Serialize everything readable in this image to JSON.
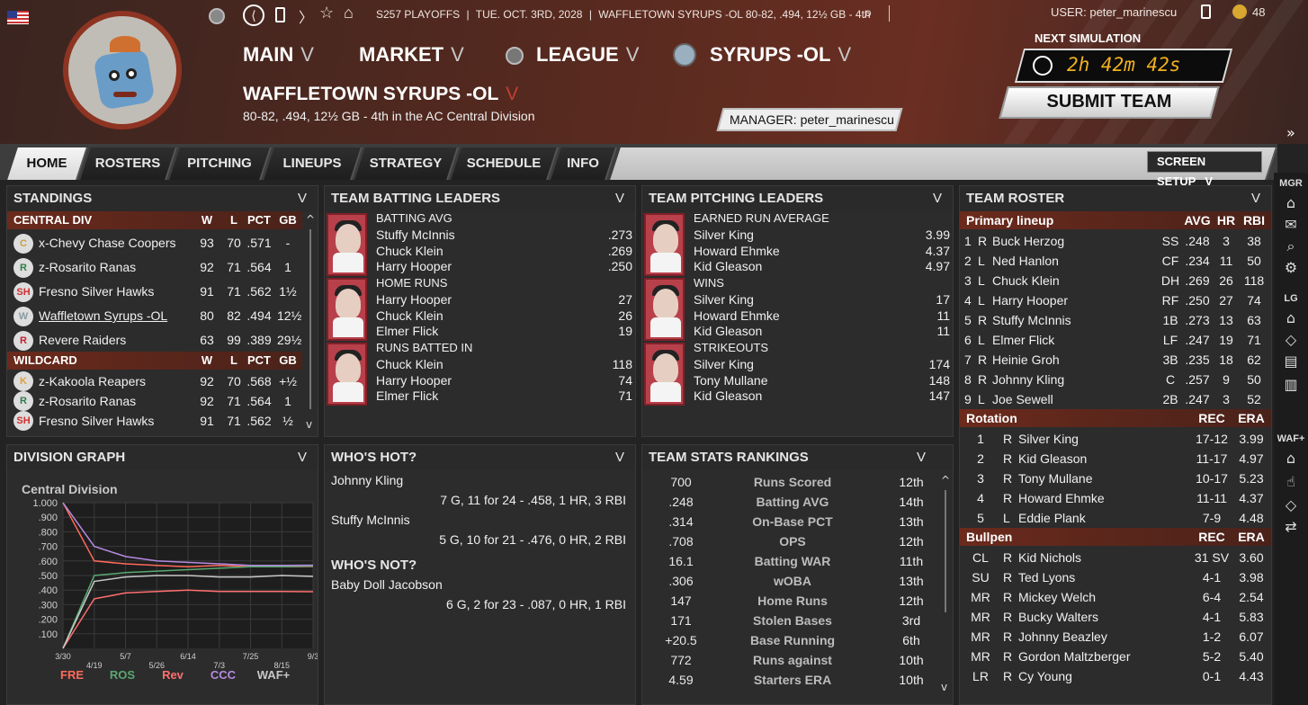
{
  "header": {
    "season_status": "S257 PLAYOFFS",
    "date": "TUE. OCT. 3RD, 2028",
    "team_summary": "WAFFLETOWN SYRUPS -OL  80-82, .494, 12½ GB - 4th",
    "user_label": "USER: peter_marinescu",
    "coins": "48",
    "nav_main": "MAIN",
    "nav_market": "MARKET",
    "nav_league": "LEAGUE",
    "nav_team": "SYRUPS -OL",
    "team_name": "WAFFLETOWN SYRUPS -OL",
    "team_record": "80-82, .494, 12½ GB - 4th in the AC Central Division",
    "manager_label": "MANAGER:",
    "manager_name": "peter_marinescu",
    "next_sim_label": "NEXT SIMULATION",
    "next_sim_time": "2h 42m 42s",
    "submit_label": "SUBMIT TEAM",
    "chev": "V"
  },
  "tabs": [
    "HOME",
    "ROSTERS",
    "PITCHING",
    "LINEUPS",
    "STRATEGY",
    "SCHEDULE",
    "INFO"
  ],
  "screen_setup": "SCREEN SETUP",
  "standings": {
    "title": "STANDINGS",
    "div_header": [
      "CENTRAL DIV",
      "W",
      "L",
      "PCT",
      "GB"
    ],
    "div_rows": [
      {
        "team": "x-Chevy Chase Coopers",
        "w": "93",
        "l": "70",
        "pct": ".571",
        "gb": "-",
        "logo": "C",
        "color": "#c8a040"
      },
      {
        "team": "z-Rosarito Ranas",
        "w": "92",
        "l": "71",
        "pct": ".564",
        "gb": "1",
        "logo": "R",
        "color": "#2e7d4a"
      },
      {
        "team": "Fresno Silver Hawks",
        "w": "91",
        "l": "71",
        "pct": ".562",
        "gb": "1½",
        "logo": "SH",
        "color": "#d03030"
      },
      {
        "team": "Waffletown Syrups -OL",
        "w": "80",
        "l": "82",
        "pct": ".494",
        "gb": "12½",
        "logo": "W",
        "color": "#8a9aa0"
      },
      {
        "team": "Revere Raiders",
        "w": "63",
        "l": "99",
        "pct": ".389",
        "gb": "29½",
        "logo": "R",
        "color": "#c02030"
      }
    ],
    "wc_header": [
      "WILDCARD",
      "W",
      "L",
      "PCT",
      "GB"
    ],
    "wc_rows": [
      {
        "team": "z-Kakoola Reapers",
        "w": "92",
        "l": "70",
        "pct": ".568",
        "gb": "+½",
        "logo": "K",
        "color": "#e0a030"
      },
      {
        "team": "z-Rosarito Ranas",
        "w": "92",
        "l": "71",
        "pct": ".564",
        "gb": "1",
        "logo": "R",
        "color": "#2e7d4a"
      },
      {
        "team": "Fresno Silver Hawks",
        "w": "91",
        "l": "71",
        "pct": ".562",
        "gb": "½",
        "logo": "SH",
        "color": "#d03030"
      }
    ]
  },
  "batting_leaders": {
    "title": "TEAM BATTING LEADERS",
    "groups": [
      {
        "stat": "BATTING AVG",
        "players": [
          [
            "Stuffy McInnis",
            ".273"
          ],
          [
            "Chuck Klein",
            ".269"
          ],
          [
            "Harry Hooper",
            ".250"
          ]
        ]
      },
      {
        "stat": "HOME RUNS",
        "players": [
          [
            "Harry Hooper",
            "27"
          ],
          [
            "Chuck Klein",
            "26"
          ],
          [
            "Elmer Flick",
            "19"
          ]
        ]
      },
      {
        "stat": "RUNS BATTED IN",
        "players": [
          [
            "Chuck Klein",
            "118"
          ],
          [
            "Harry Hooper",
            "74"
          ],
          [
            "Elmer Flick",
            "71"
          ]
        ]
      }
    ]
  },
  "pitching_leaders": {
    "title": "TEAM PITCHING LEADERS",
    "groups": [
      {
        "stat": "EARNED RUN AVERAGE",
        "players": [
          [
            "Silver King",
            "3.99"
          ],
          [
            "Howard Ehmke",
            "4.37"
          ],
          [
            "Kid Gleason",
            "4.97"
          ]
        ]
      },
      {
        "stat": "WINS",
        "players": [
          [
            "Silver King",
            "17"
          ],
          [
            "Howard Ehmke",
            "11"
          ],
          [
            "Kid Gleason",
            "11"
          ]
        ]
      },
      {
        "stat": "STRIKEOUTS",
        "players": [
          [
            "Silver King",
            "174"
          ],
          [
            "Tony Mullane",
            "148"
          ],
          [
            "Kid Gleason",
            "147"
          ]
        ]
      }
    ]
  },
  "roster": {
    "title": "TEAM ROSTER",
    "lineup_header": [
      "Primary lineup",
      "AVG",
      "HR",
      "RBI"
    ],
    "lineup": [
      [
        "1",
        "R",
        "Buck Herzog",
        "SS",
        ".248",
        "3",
        "38"
      ],
      [
        "2",
        "L",
        "Ned Hanlon",
        "CF",
        ".234",
        "11",
        "50"
      ],
      [
        "3",
        "L",
        "Chuck Klein",
        "DH",
        ".269",
        "26",
        "118"
      ],
      [
        "4",
        "L",
        "Harry Hooper",
        "RF",
        ".250",
        "27",
        "74"
      ],
      [
        "5",
        "R",
        "Stuffy McInnis",
        "1B",
        ".273",
        "13",
        "63"
      ],
      [
        "6",
        "L",
        "Elmer Flick",
        "LF",
        ".247",
        "19",
        "71"
      ],
      [
        "7",
        "R",
        "Heinie Groh",
        "3B",
        ".235",
        "18",
        "62"
      ],
      [
        "8",
        "R",
        "Johnny Kling",
        "C",
        ".257",
        "9",
        "50"
      ],
      [
        "9",
        "L",
        "Joe Sewell",
        "2B",
        ".247",
        "3",
        "52"
      ]
    ],
    "rotation_header": [
      "Rotation",
      "REC",
      "ERA"
    ],
    "rotation": [
      [
        "1",
        "R",
        "Silver King",
        "17-12",
        "3.99"
      ],
      [
        "2",
        "R",
        "Kid Gleason",
        "11-17",
        "4.97"
      ],
      [
        "3",
        "R",
        "Tony Mullane",
        "10-17",
        "5.23"
      ],
      [
        "4",
        "R",
        "Howard Ehmke",
        "11-11",
        "4.37"
      ],
      [
        "5",
        "L",
        "Eddie Plank",
        "7-9",
        "4.48"
      ]
    ],
    "bullpen_header": [
      "Bullpen",
      "REC",
      "ERA"
    ],
    "bullpen": [
      [
        "CL",
        "R",
        "Kid Nichols",
        "31 SV",
        "3.60"
      ],
      [
        "SU",
        "R",
        "Ted Lyons",
        "4-1",
        "3.98"
      ],
      [
        "MR",
        "R",
        "Mickey Welch",
        "6-4",
        "2.54"
      ],
      [
        "MR",
        "R",
        "Bucky Walters",
        "4-1",
        "5.83"
      ],
      [
        "MR",
        "R",
        "Johnny Beazley",
        "1-2",
        "6.07"
      ],
      [
        "MR",
        "R",
        "Gordon Maltzberger",
        "5-2",
        "5.40"
      ],
      [
        "LR",
        "R",
        "Cy Young",
        "0-1",
        "4.43"
      ]
    ]
  },
  "division_graph": {
    "title": "DIVISION GRAPH",
    "chart_title": "Central Division",
    "yticks": [
      "1.000",
      ".900",
      ".800",
      ".700",
      ".600",
      ".500",
      ".400",
      ".300",
      ".200",
      ".100"
    ],
    "xticks": [
      "3/30",
      "4/19",
      "5/7",
      "5/26",
      "6/14",
      "7/3",
      "7/25",
      "8/15",
      "9/3"
    ],
    "legend": [
      {
        "name": "FRE",
        "color": "#ff6a5a"
      },
      {
        "name": "ROS",
        "color": "#5aa870"
      },
      {
        "name": "Rev",
        "color": "#ff6f6f"
      },
      {
        "name": "CCC",
        "color": "#b48ae0"
      },
      {
        "name": "WAF+",
        "color": "#c8c8c8"
      }
    ]
  },
  "chart_data": {
    "type": "line",
    "title": "Central Division",
    "x": [
      "3/30",
      "4/19",
      "5/7",
      "5/26",
      "6/14",
      "7/3",
      "7/25",
      "8/15",
      "9/3"
    ],
    "ylim": [
      0,
      1
    ],
    "series": [
      {
        "name": "FRE",
        "values": [
          1.0,
          0.6,
          0.58,
          0.57,
          0.56,
          0.57,
          0.56,
          0.56,
          0.562
        ]
      },
      {
        "name": "ROS",
        "values": [
          0.0,
          0.5,
          0.52,
          0.53,
          0.54,
          0.55,
          0.56,
          0.56,
          0.564
        ]
      },
      {
        "name": "Rev",
        "values": [
          0.0,
          0.34,
          0.38,
          0.39,
          0.4,
          0.39,
          0.39,
          0.39,
          0.389
        ]
      },
      {
        "name": "CCC",
        "values": [
          1.0,
          0.7,
          0.63,
          0.6,
          0.59,
          0.58,
          0.57,
          0.57,
          0.571
        ]
      },
      {
        "name": "WAF+",
        "values": [
          0.0,
          0.46,
          0.49,
          0.5,
          0.5,
          0.49,
          0.49,
          0.5,
          0.494
        ]
      }
    ]
  },
  "whos_hot": {
    "title": "WHO'S HOT?",
    "players": [
      {
        "name": "Johnny Kling",
        "line": "7 G, 11 for 24 - .458, 1 HR, 3 RBI"
      },
      {
        "name": "Stuffy McInnis",
        "line": "5 G, 10 for 21 - .476, 0 HR, 2 RBI"
      }
    ]
  },
  "whos_not": {
    "title": "WHO'S NOT?",
    "players": [
      {
        "name": "Baby Doll Jacobson",
        "line": "6 G, 2 for 23 - .087, 0 HR, 1 RBI"
      }
    ]
  },
  "team_rankings": {
    "title": "TEAM STATS RANKINGS",
    "rows": [
      [
        "700",
        "Runs Scored",
        "12th"
      ],
      [
        ".248",
        "Batting AVG",
        "14th"
      ],
      [
        ".314",
        "On-Base PCT",
        "13th"
      ],
      [
        ".708",
        "OPS",
        "12th"
      ],
      [
        "16.1",
        "Batting WAR",
        "11th"
      ],
      [
        ".306",
        "wOBA",
        "13th"
      ],
      [
        "147",
        "Home Runs",
        "12th"
      ],
      [
        "171",
        "Stolen Bases",
        "3rd"
      ],
      [
        "+20.5",
        "Base Running",
        "6th"
      ],
      [
        "772",
        "Runs against",
        "10th"
      ],
      [
        "4.59",
        "Starters ERA",
        "10th"
      ]
    ]
  },
  "side": {
    "mgr": "MGR",
    "lg": "LG",
    "waf": "WAF+"
  }
}
